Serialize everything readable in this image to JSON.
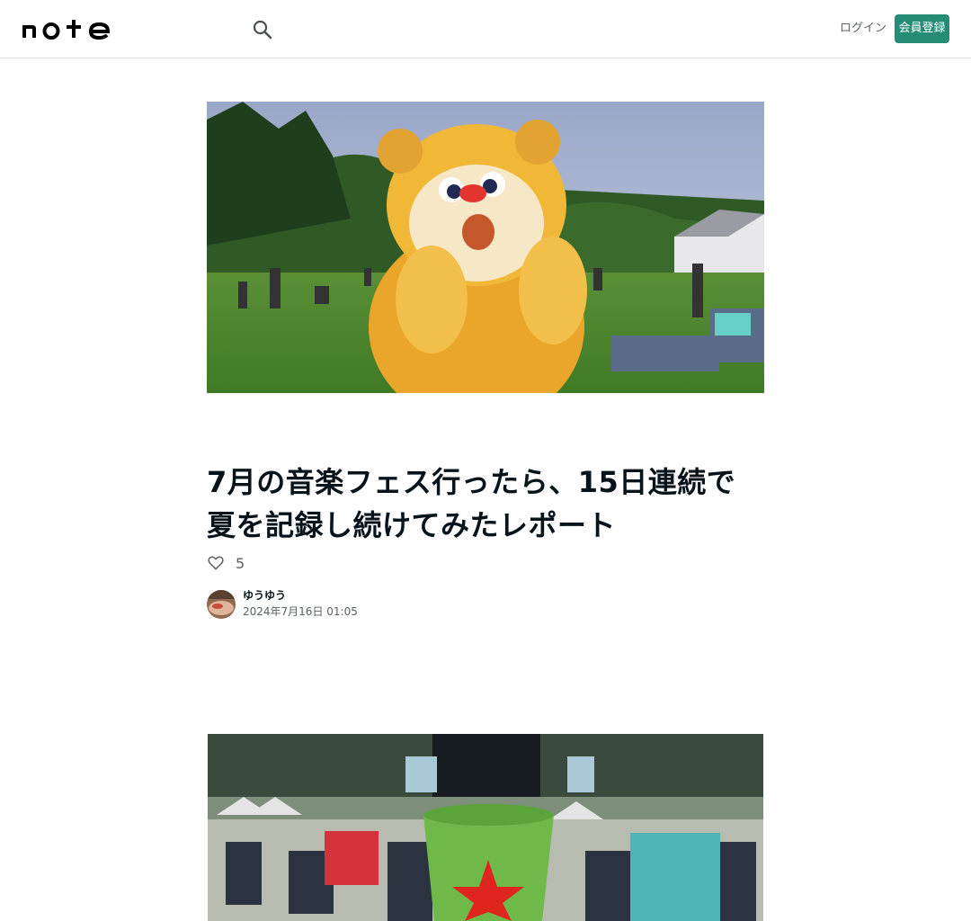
{
  "header": {
    "logo_text": "note",
    "login_label": "ログイン",
    "signup_label": "会員登録"
  },
  "article": {
    "title": "7月の音楽フェス行ったら、15日連続で夏を記録し続けてみたレポート",
    "likes": "5",
    "author_name": "ゆうゆう",
    "date": "2024年7月16日 01:05"
  },
  "colors": {
    "accent": "#258d76",
    "text": "#08131a",
    "subtext": "#5b5f63",
    "border": "#dddfe1"
  },
  "icons": {
    "search": "search-icon",
    "like": "heart-icon"
  }
}
